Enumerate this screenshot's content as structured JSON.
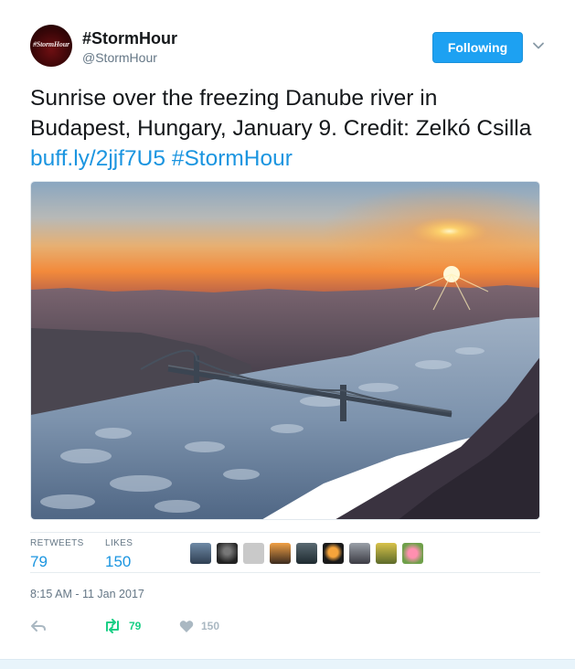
{
  "header": {
    "avatar_text": "#StormHour",
    "display_name": "#StormHour",
    "handle": "@StormHour",
    "follow_button_label": "Following"
  },
  "tweet": {
    "text_plain": "Sunrise over the freezing Danube river in Budapest, Hungary, January 9. Credit: Zelkó Csilla",
    "link": "buff.ly/2jjf7U5",
    "hashtag": "#StormHour"
  },
  "stats": {
    "retweets_label": "RETWEETS",
    "retweets_count": "79",
    "likes_label": "LIKES",
    "likes_count": "150"
  },
  "timestamp": "8:15 AM - 11 Jan 2017",
  "actions": {
    "reply_icon": "reply-icon",
    "retweet_icon": "retweet-icon",
    "retweet_count": "79",
    "like_icon": "heart-icon",
    "like_count": "150"
  },
  "colors": {
    "accent": "#1da1f2",
    "link": "#1b95e0",
    "retweet_active": "#19cf86",
    "muted": "#657786"
  }
}
